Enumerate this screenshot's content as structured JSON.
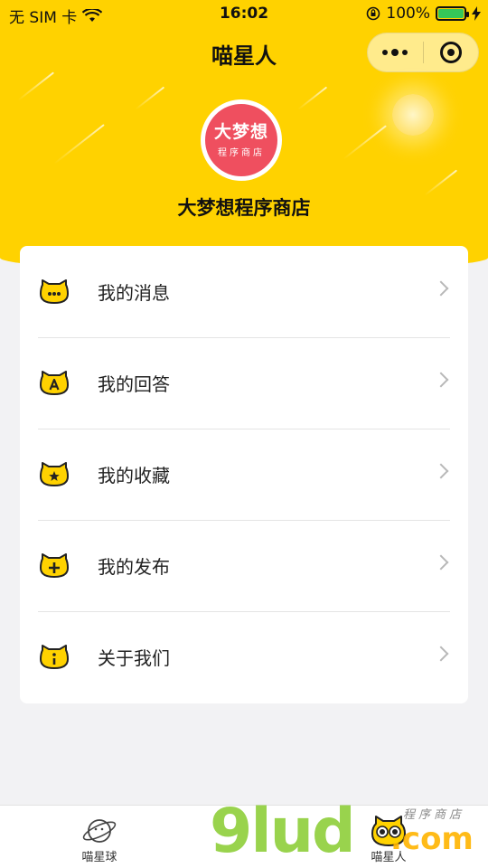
{
  "status_bar": {
    "carrier": "无 SIM 卡",
    "time": "16:02",
    "battery": "100%",
    "battery_level": 1.0
  },
  "nav": {
    "title": "喵星人"
  },
  "profile": {
    "avatar_main": "大梦想",
    "avatar_sub": "程序商店",
    "name": "大梦想程序商店"
  },
  "menu": {
    "items": [
      {
        "label": "我的消息",
        "icon": "cat-message-icon"
      },
      {
        "label": "我的回答",
        "icon": "cat-answer-icon"
      },
      {
        "label": "我的收藏",
        "icon": "cat-star-icon"
      },
      {
        "label": "我的发布",
        "icon": "cat-plus-icon"
      },
      {
        "label": "关于我们",
        "icon": "cat-info-icon"
      }
    ]
  },
  "tabbar": {
    "tabs": [
      {
        "label": "喵星球",
        "icon": "planet-icon"
      },
      {
        "label": "喵星人",
        "icon": "cat-face-icon"
      }
    ]
  },
  "watermark": {
    "brand": "9lud",
    "suffix": ".com",
    "sub": "程序商店"
  },
  "colors": {
    "accent": "#ffd200",
    "avatar_bg": "#ef4f5f"
  }
}
